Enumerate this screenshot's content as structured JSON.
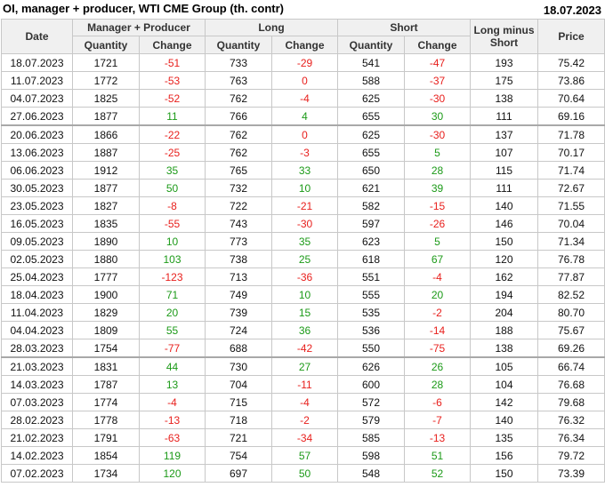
{
  "header": {
    "title": "OI, manager + producer, WTI CME Group (th. contr)",
    "date": "18.07.2023"
  },
  "columns": {
    "date": "Date",
    "mp": "Manager + Producer",
    "long": "Long",
    "short": "Short",
    "lms": "Long minus Short",
    "price": "Price",
    "quantity": "Quantity",
    "change": "Change"
  },
  "rows": [
    {
      "date": "18.07.2023",
      "mp_q": "1721",
      "mp_c": "-51",
      "l_q": "733",
      "l_c": "-29",
      "s_q": "541",
      "s_c": "-47",
      "lms": "193",
      "price": "75.42"
    },
    {
      "date": "11.07.2023",
      "mp_q": "1772",
      "mp_c": "-53",
      "l_q": "763",
      "l_c": "0",
      "s_q": "588",
      "s_c": "-37",
      "lms": "175",
      "price": "73.86"
    },
    {
      "date": "04.07.2023",
      "mp_q": "1825",
      "mp_c": "-52",
      "l_q": "762",
      "l_c": "-4",
      "s_q": "625",
      "s_c": "-30",
      "lms": "138",
      "price": "70.64"
    },
    {
      "date": "27.06.2023",
      "mp_q": "1877",
      "mp_c": "11",
      "l_q": "766",
      "l_c": "4",
      "s_q": "655",
      "s_c": "30",
      "lms": "111",
      "price": "69.16"
    },
    {
      "date": "20.06.2023",
      "mp_q": "1866",
      "mp_c": "-22",
      "l_q": "762",
      "l_c": "0",
      "s_q": "625",
      "s_c": "-30",
      "lms": "137",
      "price": "71.78"
    },
    {
      "date": "13.06.2023",
      "mp_q": "1887",
      "mp_c": "-25",
      "l_q": "762",
      "l_c": "-3",
      "s_q": "655",
      "s_c": "5",
      "lms": "107",
      "price": "70.17"
    },
    {
      "date": "06.06.2023",
      "mp_q": "1912",
      "mp_c": "35",
      "l_q": "765",
      "l_c": "33",
      "s_q": "650",
      "s_c": "28",
      "lms": "115",
      "price": "71.74"
    },
    {
      "date": "30.05.2023",
      "mp_q": "1877",
      "mp_c": "50",
      "l_q": "732",
      "l_c": "10",
      "s_q": "621",
      "s_c": "39",
      "lms": "111",
      "price": "72.67"
    },
    {
      "date": "23.05.2023",
      "mp_q": "1827",
      "mp_c": "-8",
      "l_q": "722",
      "l_c": "-21",
      "s_q": "582",
      "s_c": "-15",
      "lms": "140",
      "price": "71.55"
    },
    {
      "date": "16.05.2023",
      "mp_q": "1835",
      "mp_c": "-55",
      "l_q": "743",
      "l_c": "-30",
      "s_q": "597",
      "s_c": "-26",
      "lms": "146",
      "price": "70.04"
    },
    {
      "date": "09.05.2023",
      "mp_q": "1890",
      "mp_c": "10",
      "l_q": "773",
      "l_c": "35",
      "s_q": "623",
      "s_c": "5",
      "lms": "150",
      "price": "71.34"
    },
    {
      "date": "02.05.2023",
      "mp_q": "1880",
      "mp_c": "103",
      "l_q": "738",
      "l_c": "25",
      "s_q": "618",
      "s_c": "67",
      "lms": "120",
      "price": "76.78"
    },
    {
      "date": "25.04.2023",
      "mp_q": "1777",
      "mp_c": "-123",
      "l_q": "713",
      "l_c": "-36",
      "s_q": "551",
      "s_c": "-4",
      "lms": "162",
      "price": "77.87"
    },
    {
      "date": "18.04.2023",
      "mp_q": "1900",
      "mp_c": "71",
      "l_q": "749",
      "l_c": "10",
      "s_q": "555",
      "s_c": "20",
      "lms": "194",
      "price": "82.52"
    },
    {
      "date": "11.04.2023",
      "mp_q": "1829",
      "mp_c": "20",
      "l_q": "739",
      "l_c": "15",
      "s_q": "535",
      "s_c": "-2",
      "lms": "204",
      "price": "80.70"
    },
    {
      "date": "04.04.2023",
      "mp_q": "1809",
      "mp_c": "55",
      "l_q": "724",
      "l_c": "36",
      "s_q": "536",
      "s_c": "-14",
      "lms": "188",
      "price": "75.67"
    },
    {
      "date": "28.03.2023",
      "mp_q": "1754",
      "mp_c": "-77",
      "l_q": "688",
      "l_c": "-42",
      "s_q": "550",
      "s_c": "-75",
      "lms": "138",
      "price": "69.26"
    },
    {
      "date": "21.03.2023",
      "mp_q": "1831",
      "mp_c": "44",
      "l_q": "730",
      "l_c": "27",
      "s_q": "626",
      "s_c": "26",
      "lms": "105",
      "price": "66.74"
    },
    {
      "date": "14.03.2023",
      "mp_q": "1787",
      "mp_c": "13",
      "l_q": "704",
      "l_c": "-11",
      "s_q": "600",
      "s_c": "28",
      "lms": "104",
      "price": "76.68"
    },
    {
      "date": "07.03.2023",
      "mp_q": "1774",
      "mp_c": "-4",
      "l_q": "715",
      "l_c": "-4",
      "s_q": "572",
      "s_c": "-6",
      "lms": "142",
      "price": "79.68"
    },
    {
      "date": "28.02.2023",
      "mp_q": "1778",
      "mp_c": "-13",
      "l_q": "718",
      "l_c": "-2",
      "s_q": "579",
      "s_c": "-7",
      "lms": "140",
      "price": "76.32"
    },
    {
      "date": "21.02.2023",
      "mp_q": "1791",
      "mp_c": "-63",
      "l_q": "721",
      "l_c": "-34",
      "s_q": "585",
      "s_c": "-13",
      "lms": "135",
      "price": "76.34"
    },
    {
      "date": "14.02.2023",
      "mp_q": "1854",
      "mp_c": "119",
      "l_q": "754",
      "l_c": "57",
      "s_q": "598",
      "s_c": "51",
      "lms": "156",
      "price": "79.72"
    },
    {
      "date": "07.02.2023",
      "mp_q": "1734",
      "mp_c": "120",
      "l_q": "697",
      "l_c": "50",
      "s_q": "548",
      "s_c": "52",
      "lms": "150",
      "price": "73.39"
    }
  ],
  "colors": {
    "negative": "#e8201d",
    "positive": "#1c9a18",
    "header_bg": "#f0f0f0",
    "grid": "#c8c8c8"
  }
}
